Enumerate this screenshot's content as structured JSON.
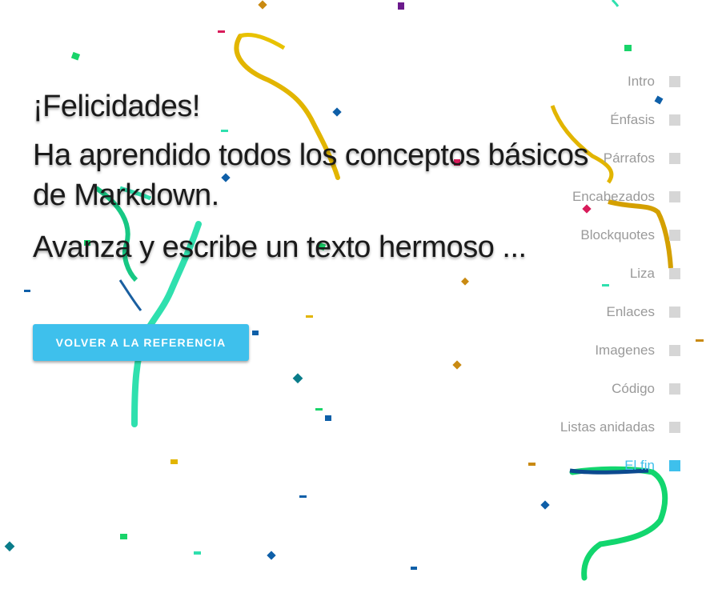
{
  "heading": "¡Felicidades!",
  "subheading": "Ha aprendido todos los conceptos básicos de Markdown.",
  "tagline": "Avanza y escribe un texto hermoso ...",
  "button_label": "VOLVER A LA REFERENCIA",
  "nav": {
    "items": [
      {
        "label": "Intro",
        "active": false
      },
      {
        "label": "Énfasis",
        "active": false
      },
      {
        "label": "Párrafos",
        "active": false
      },
      {
        "label": "Encabezados",
        "active": false
      },
      {
        "label": "Blockquotes",
        "active": false
      },
      {
        "label": "Liza",
        "active": false
      },
      {
        "label": "Enlaces",
        "active": false
      },
      {
        "label": "Imagenes",
        "active": false
      },
      {
        "label": "Código",
        "active": false
      },
      {
        "label": "Listas anidadas",
        "active": false
      },
      {
        "label": "El fin",
        "active": true
      }
    ]
  },
  "colors": {
    "accent": "#3ec0ec",
    "nav_inactive_text": "#9a9a9a",
    "nav_inactive_square": "#d6d6d6"
  }
}
